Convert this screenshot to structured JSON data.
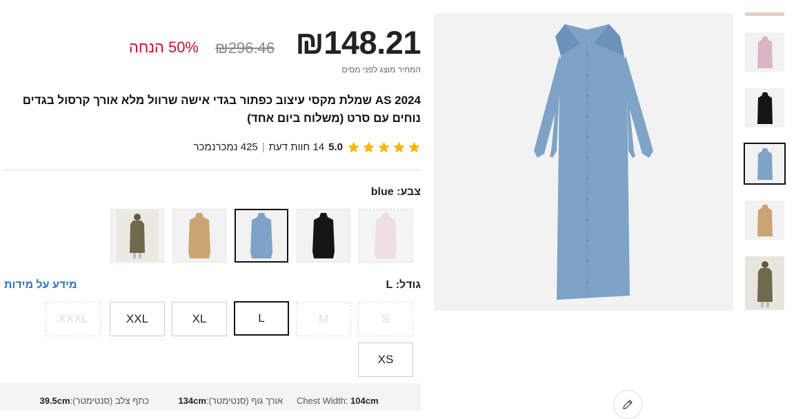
{
  "price": {
    "current": "₪148.21",
    "original": "₪296.46",
    "discount": "50% הנחה",
    "tax_note": "המחיר מוצג לפני מסים"
  },
  "product": {
    "title": "AS 2024 שמלת מקסי עיצוב כפתור בגדי אישה שרוול מלא אורך קרסול בגדים נוחים עם סרט (משלוח ביום אחד)"
  },
  "rating": {
    "value": "5.0",
    "reviews": "14 חוות דעת",
    "sold": "425 נמכרנמכר",
    "star_color": "#f5b800",
    "stars": 5
  },
  "color": {
    "label": "צבע:",
    "selected": "blue",
    "swatches": [
      {
        "name": "pink",
        "status": "unavailable"
      },
      {
        "name": "black",
        "status": "available"
      },
      {
        "name": "blue",
        "status": "selected"
      },
      {
        "name": "camel",
        "status": "available"
      },
      {
        "name": "olive",
        "status": "available"
      }
    ]
  },
  "size": {
    "label": "גודל:",
    "selected": "L",
    "guide": "מידע על מידות",
    "options": [
      {
        "label": "S",
        "status": "disabled"
      },
      {
        "label": "M",
        "status": "disabled"
      },
      {
        "label": "L",
        "status": "selected"
      },
      {
        "label": "XL",
        "status": "available"
      },
      {
        "label": "XXL",
        "status": "available"
      },
      {
        "label": "XXXL",
        "status": "disabled"
      },
      {
        "label": "XS",
        "status": "available"
      }
    ]
  },
  "measurements": [
    {
      "label": "Chest Width:",
      "value": "104cm"
    },
    {
      "label": "אורך גוף (סנטימטר):",
      "value": "134cm"
    },
    {
      "label": "כתף צלב (סנטימטר):",
      "value": "39.5cm"
    }
  ],
  "gallery": {
    "thumbnails": [
      "pink",
      "black",
      "blue",
      "camel",
      "olive"
    ],
    "selected": "blue"
  },
  "colors": {
    "accent_red": "#c8102e",
    "link_blue": "#2874c7",
    "dress_blue": "#7fa3c6"
  },
  "icons": {
    "star": "star-icon",
    "edit": "pencil-icon"
  }
}
